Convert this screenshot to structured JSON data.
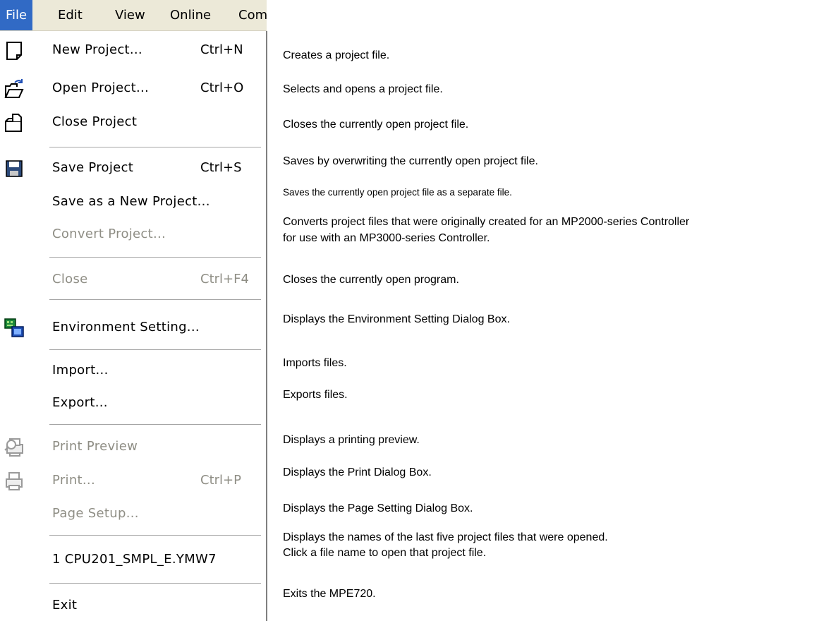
{
  "menubar": {
    "items": [
      {
        "label": "File",
        "active": true
      },
      {
        "label": "Edit"
      },
      {
        "label": "View"
      },
      {
        "label": "Online"
      },
      {
        "label": "Com"
      }
    ]
  },
  "menu": {
    "items": [
      {
        "label": "New Project...",
        "shortcut": "Ctrl+N",
        "icon": "new-document-icon",
        "enabled": true
      },
      {
        "label": "Open Project...",
        "shortcut": "Ctrl+O",
        "icon": "open-folder-icon",
        "enabled": true
      },
      {
        "label": "Close Project",
        "shortcut": "",
        "icon": "close-folder-icon",
        "enabled": true
      },
      {
        "label": "Save Project",
        "shortcut": "Ctrl+S",
        "icon": "save-disk-icon",
        "enabled": true
      },
      {
        "label": "Save as a New Project...",
        "shortcut": "",
        "icon": "",
        "enabled": true
      },
      {
        "label": "Convert Project...",
        "shortcut": "",
        "icon": "",
        "enabled": false
      },
      {
        "label": "Close",
        "shortcut": "Ctrl+F4",
        "icon": "",
        "enabled": false
      },
      {
        "label": "Environment Setting...",
        "shortcut": "",
        "icon": "environment-setting-icon",
        "enabled": true
      },
      {
        "label": "Import...",
        "shortcut": "",
        "icon": "",
        "enabled": true
      },
      {
        "label": "Export...",
        "shortcut": "",
        "icon": "",
        "enabled": true
      },
      {
        "label": "Print Preview",
        "shortcut": "",
        "icon": "print-preview-icon",
        "enabled": false
      },
      {
        "label": "Print...",
        "shortcut": "Ctrl+P",
        "icon": "printer-icon",
        "enabled": false
      },
      {
        "label": "Page Setup...",
        "shortcut": "",
        "icon": "",
        "enabled": false
      },
      {
        "label": "1 CPU201_SMPL_E.YMW7",
        "shortcut": "",
        "icon": "",
        "enabled": true
      },
      {
        "label": "Exit",
        "shortcut": "",
        "icon": "",
        "enabled": true
      }
    ]
  },
  "descriptions": [
    "Creates a project file.",
    "Selects and opens a project file.",
    "Closes the currently open project file.",
    "Saves by overwriting the currently open project file.",
    "Saves the currently open project file as a separate file.",
    "Converts project files that were originally created for an MP2000-series Controller",
    "for use with an MP3000-series Controller.",
    "Closes the currently open program.",
    "Displays the Environment Setting Dialog Box.",
    "Imports files.",
    "Exports files.",
    "Displays a printing preview.",
    "Displays the Print Dialog Box.",
    "Displays the Page Setting Dialog Box.",
    "Displays the names of the last five project files that were opened.",
    "Click a file name to open that project file.",
    "Exits the MPE720."
  ],
  "colors": {
    "menubar_bg": "#ece9d8",
    "active_bg": "#316ac5",
    "disabled_text": "#8f8e85"
  }
}
